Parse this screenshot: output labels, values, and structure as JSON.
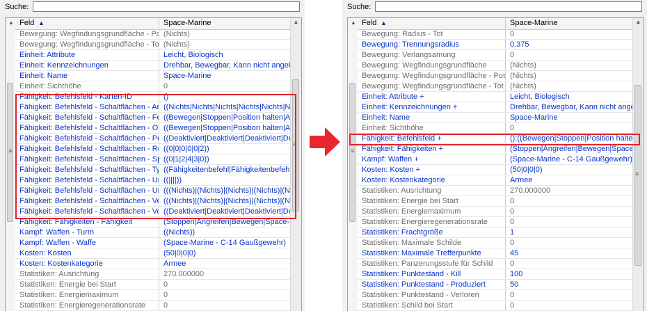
{
  "panels": [
    {
      "search_label": "Suche:",
      "search_value": "",
      "col_feld": "Feld",
      "col_value": "Space-Marine",
      "rows": [
        {
          "field": "Bewegung: Wegfindungsgrundfläche - Positi",
          "value": "(Nichts)",
          "style": "gray"
        },
        {
          "field": "Bewegung: Wegfindungsgrundfläche - Tot",
          "value": "(Nichts)",
          "style": "gray"
        },
        {
          "field": "Einheit: Attribute",
          "value": "Leicht, Biologisch",
          "style": "blue"
        },
        {
          "field": "Einheit: Kennzeichnungen",
          "value": "Drehbar, Bewegbar, Kann nicht angeklick",
          "style": "blue"
        },
        {
          "field": "Einheit: Name",
          "value": "Space-Marine",
          "style": "blue"
        },
        {
          "field": "Einheit: Sichthöhe",
          "value": "0",
          "style": "gray"
        },
        {
          "field": "Fähigkeit: Befehlsfeld - Karten-ID",
          "value": "()",
          "style": "blue"
        },
        {
          "field": "Fähigkeit: Befehlsfeld - Schaltflächen - Anfor",
          "value": "((Nichts|Nichts|Nichts|Nichts|Nichts|Nichts)",
          "style": "blue"
        },
        {
          "field": "Fähigkeit: Befehlsfeld - Schaltflächen - Fertig",
          "value": "((Bewegen|Stoppen|Position halten|Angreif",
          "style": "blue"
        },
        {
          "field": "Fähigkeit: Befehlsfeld - Schaltflächen - Oberf",
          "value": "((Bewegen|Stoppen|Position halten|Angreif",
          "style": "blue"
        },
        {
          "field": "Fähigkeit: Befehlsfeld - Schaltflächen - Perma",
          "value": "((Deaktiviert|Deaktiviert|Deaktiviert|Deaktiv",
          "style": "blue"
        },
        {
          "field": "Fähigkeit: Befehlsfeld - Schaltflächen - Reihe",
          "value": "((0|0|0|0|0|2))",
          "style": "blue"
        },
        {
          "field": "Fähigkeit: Befehlsfeld - Schaltflächen - Spalte",
          "value": "((0|1|2|4|3|0))",
          "style": "blue"
        },
        {
          "field": "Fähigkeit: Befehlsfeld - Schaltflächen - Typ",
          "value": "((Fähigkeitenbefehl|Fähigkeitenbefehl|Fähi",
          "style": "blue"
        },
        {
          "field": "Fähigkeit: Befehlsfeld - Schaltflächen - Unter",
          "value": "((||||))",
          "style": "blue"
        },
        {
          "field": "Fähigkeit: Befehlsfeld - Schaltflächen - Unter",
          "value": "(((Nichts)|(Nichts)|(Nichts)|(Nichts)|(Nichts)|(",
          "style": "blue"
        },
        {
          "field": "Fähigkeit: Befehlsfeld - Schaltflächen - Verha",
          "value": "(((Nichts)|(Nichts)|(Nichts)|(Nichts)|(Nichts)|(",
          "style": "blue"
        },
        {
          "field": "Fähigkeit: Befehlsfeld - Schaltflächen - Vollst",
          "value": "((Deaktiviert|Deaktiviert|Deaktiviert|Deaktiv",
          "style": "blue"
        },
        {
          "field": "Fähigkeit: Fähigkeiten - Fähigkeit",
          "value": "(Stoppen|Angreifen|Bewegen|Space-Marin",
          "style": "blue"
        },
        {
          "field": "Kampf: Waffen - Turm",
          "value": "((Nichts))",
          "style": "blue"
        },
        {
          "field": "Kampf: Waffen - Waffe",
          "value": "(Space-Marine - C-14 Gaußgewehr)",
          "style": "blue"
        },
        {
          "field": "Kosten: Kosten",
          "value": "(50|0|0|0)",
          "style": "blue"
        },
        {
          "field": "Kosten: Kostenkategorie",
          "value": "Armee",
          "style": "blue"
        },
        {
          "field": "Statistiken: Ausrichtung",
          "value": "270.000000",
          "style": "gray"
        },
        {
          "field": "Statistiken: Energie bei Start",
          "value": "0",
          "style": "gray"
        },
        {
          "field": "Statistiken: Energiemaximum",
          "value": "0",
          "style": "gray"
        },
        {
          "field": "Statistiken: Energieregenerationsrate",
          "value": "0",
          "style": "gray"
        }
      ]
    },
    {
      "search_label": "Suche:",
      "search_value": "",
      "col_feld": "Feld",
      "col_value": "Space-Marine",
      "rows": [
        {
          "field": "Bewegung: Radius - Tot",
          "value": "0",
          "style": "gray"
        },
        {
          "field": "Bewegung: Trennungsradius",
          "value": "0.375",
          "style": "blue"
        },
        {
          "field": "Bewegung: Verlangsamung",
          "value": "0",
          "style": "gray"
        },
        {
          "field": "Bewegung: Wegfindungsgrundfläche",
          "value": "(Nichts)",
          "style": "gray"
        },
        {
          "field": "Bewegung: Wegfindungsgrundfläche - Positi",
          "value": "(Nichts)",
          "style": "gray"
        },
        {
          "field": "Bewegung: Wegfindungsgrundfläche - Tot",
          "value": "(Nichts)",
          "style": "gray"
        },
        {
          "field": "Einheit: Attribute +",
          "value": "Leicht, Biologisch",
          "style": "blue"
        },
        {
          "field": "Einheit: Kennzeichnungen +",
          "value": "Drehbar, Bewegbar, Kann nicht angeklick",
          "style": "blue"
        },
        {
          "field": "Einheit: Name",
          "value": "Space-Marine",
          "style": "blue"
        },
        {
          "field": "Einheit: Sichthöhe",
          "value": "0",
          "style": "gray"
        },
        {
          "field": "Fähigkeit: Befehlsfeld +",
          "value": "():((Bewegen|Stoppen|Position halten|Angri",
          "style": "blue"
        },
        {
          "field": "Fähigkeit: Fähigkeiten +",
          "value": "(Stoppen|Angreifen|Bewegen|Space-Marin",
          "style": "blue"
        },
        {
          "field": "Kampf: Waffen +",
          "value": "(Space-Marine - C-14 Gaußgewehr):((Nich",
          "style": "blue"
        },
        {
          "field": "Kosten: Kosten +",
          "value": "(50|0|0|0)",
          "style": "blue"
        },
        {
          "field": "Kosten: Kostenkategorie",
          "value": "Armee",
          "style": "blue"
        },
        {
          "field": "Statistiken: Ausrichtung",
          "value": "270.000000",
          "style": "gray"
        },
        {
          "field": "Statistiken: Energie bei Start",
          "value": "0",
          "style": "gray"
        },
        {
          "field": "Statistiken: Energiemaximum",
          "value": "0",
          "style": "gray"
        },
        {
          "field": "Statistiken: Energieregenerationsrate",
          "value": "0",
          "style": "gray"
        },
        {
          "field": "Statistiken: Frachtgröße",
          "value": "1",
          "style": "blue"
        },
        {
          "field": "Statistiken: Maximale Schilde",
          "value": "0",
          "style": "gray"
        },
        {
          "field": "Statistiken: Maximale Trefferpunkte",
          "value": "45",
          "style": "blue"
        },
        {
          "field": "Statistiken: Panzerungsstufe für Schild",
          "value": "0",
          "style": "gray"
        },
        {
          "field": "Statistiken: Punktestand - Kill",
          "value": "100",
          "style": "blue"
        },
        {
          "field": "Statistiken: Punktestand - Produziert",
          "value": "50",
          "style": "blue"
        },
        {
          "field": "Statistiken: Punktestand - Verloren",
          "value": "0",
          "style": "gray"
        },
        {
          "field": "Statistiken: Schild bei Start",
          "value": "0",
          "style": "gray"
        }
      ]
    }
  ],
  "colors": {
    "modified": "#0a33c8",
    "default": "#6d6d6d",
    "highlight": "#e0252a"
  },
  "icons": [
    "sort-ascending-icon",
    "scroll-up-icon",
    "scroll-down-icon",
    "expand-collapse-icon",
    "grip-icon",
    "right-arrow-icon"
  ]
}
